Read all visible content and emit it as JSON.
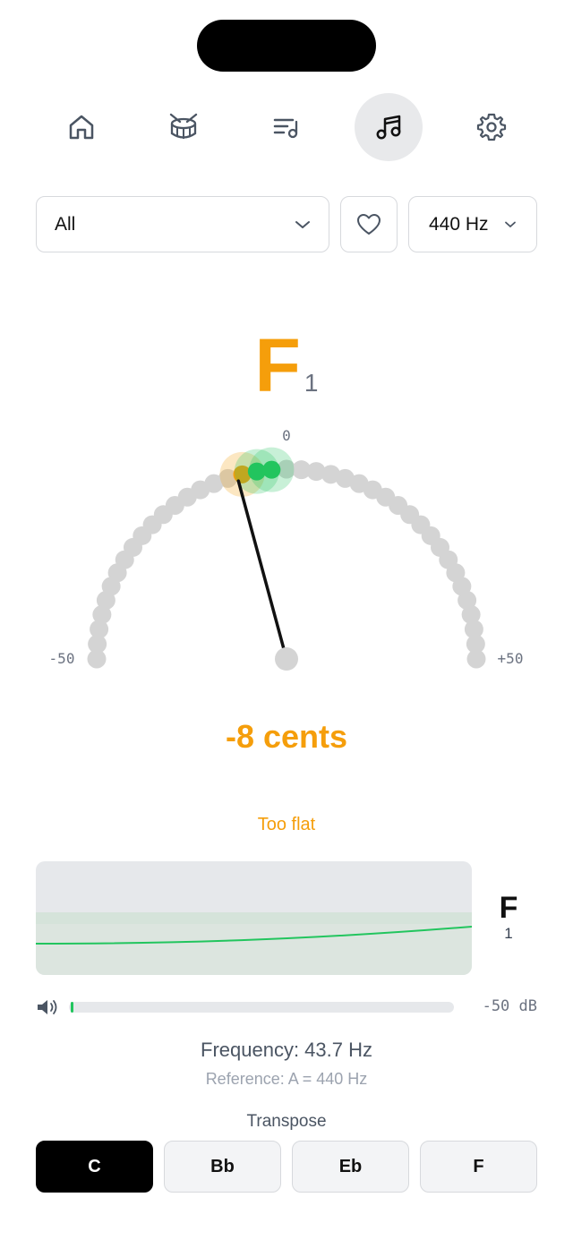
{
  "nav": {
    "items": [
      {
        "icon": "home-icon",
        "active": false
      },
      {
        "icon": "drum-icon",
        "active": false
      },
      {
        "icon": "playlist-icon",
        "active": false
      },
      {
        "icon": "music-note-icon",
        "active": true
      },
      {
        "icon": "gear-icon",
        "active": false
      }
    ]
  },
  "filters": {
    "instrument_value": "All",
    "reference_value": "440 Hz"
  },
  "note": {
    "letter": "F",
    "octave": "1"
  },
  "gauge": {
    "center_label": "0",
    "min_label": "-50",
    "max_label": "+50",
    "needle_cents": -8,
    "dot_count": 41
  },
  "cents_text": "-8 cents",
  "status_text": "Too flat",
  "history_note": {
    "letter": "F",
    "octave": "1"
  },
  "volume": {
    "level_db_text": "-50 dB",
    "level_fraction": 0.005
  },
  "frequency_text": "Frequency: 43.7 Hz",
  "reference_text": "Reference: A = 440 Hz",
  "transpose": {
    "label": "Transpose",
    "options": [
      "C",
      "Bb",
      "Eb",
      "F"
    ],
    "selected": "C"
  },
  "colors": {
    "accent": "#f59e0b",
    "in_tune": "#22c55e",
    "neutral_dot": "#d4d4d4"
  }
}
